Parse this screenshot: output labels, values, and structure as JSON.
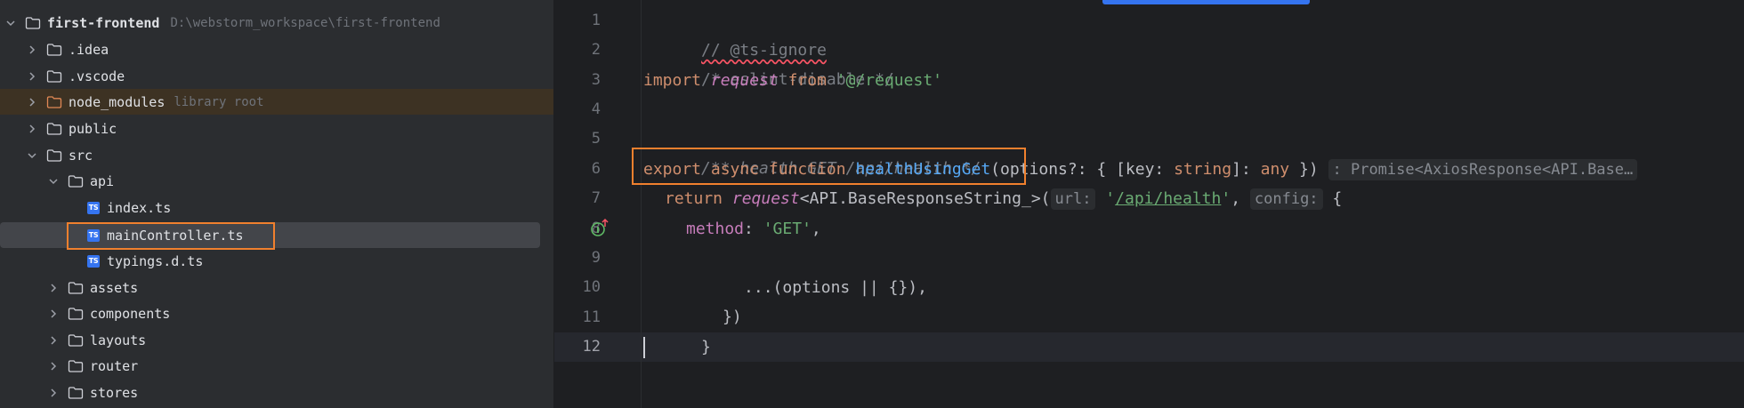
{
  "tree": {
    "root": {
      "name": "first-frontend",
      "path": "D:\\webstorm_workspace\\first-frontend"
    },
    "items": [
      {
        "name": ".idea",
        "kind": "folder",
        "expanded": false
      },
      {
        "name": ".vscode",
        "kind": "folder",
        "expanded": false
      },
      {
        "name": "node_modules",
        "kind": "folder",
        "expanded": false,
        "hint": "library root"
      },
      {
        "name": "public",
        "kind": "folder",
        "expanded": false
      },
      {
        "name": "src",
        "kind": "folder",
        "expanded": true
      },
      {
        "name": "api",
        "kind": "folder",
        "expanded": true
      },
      {
        "name": "index.ts",
        "kind": "ts-file"
      },
      {
        "name": "mainController.ts",
        "kind": "ts-file",
        "selected": true
      },
      {
        "name": "typings.d.ts",
        "kind": "ts-file"
      },
      {
        "name": "assets",
        "kind": "folder",
        "expanded": false
      },
      {
        "name": "components",
        "kind": "folder",
        "expanded": false
      },
      {
        "name": "layouts",
        "kind": "folder",
        "expanded": false
      },
      {
        "name": "router",
        "kind": "folder",
        "expanded": false
      },
      {
        "name": "stores",
        "kind": "folder",
        "expanded": false
      }
    ],
    "ts_badge": "TS"
  },
  "editor": {
    "line_numbers": [
      "1",
      "2",
      "3",
      "4",
      "5",
      "6",
      "7",
      "8",
      "9",
      "10",
      "11",
      "12"
    ],
    "current_line": "12",
    "code": {
      "l1": "// @ts-ignore",
      "l2": "/* eslint-disable */",
      "l3_import": "import",
      "l3_request": "request",
      "l3_from": "from",
      "l3_path": "'@/request'",
      "l5": "/** health GET /api/health */",
      "l6_export": "export",
      "l6_async": "async",
      "l6_function": "function",
      "l6_name": "healthUsingGet",
      "l6_params_a": "(options?: { [key: ",
      "l6_string": "string",
      "l6_params_b": "]: ",
      "l6_any": "any",
      "l6_params_c": " })",
      "l6_hint": ": Promise<AxiosResponse<API.Base…",
      "l7_return": "return",
      "l7_request": "request",
      "l7_generic": "<API.BaseResponseString_>(",
      "l7_url_hint": "url:",
      "l7_url_q1": "'",
      "l7_url": "/api/health",
      "l7_url_q2": "'",
      "l7_comma": ", ",
      "l7_config_hint": "config:",
      "l7_brace": " {",
      "l8_method": "method",
      "l8_colon": ": ",
      "l8_get": "'GET'",
      "l8_comma": ",",
      "l9": "...(options || {}),",
      "l10": "})",
      "l11": "}"
    },
    "colors": {
      "keyword": "#cf8e6d",
      "function_name": "#56a8f5",
      "string": "#6aab73",
      "comment": "#7a7e85",
      "highlight_box": "#f0802e"
    }
  }
}
